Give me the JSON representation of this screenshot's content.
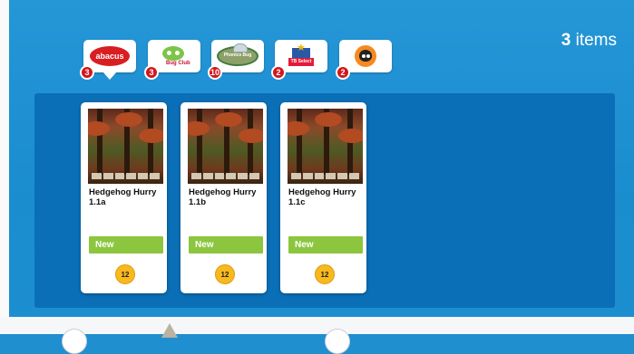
{
  "header": {
    "item_count": "3",
    "item_count_suffix": " items"
  },
  "tabs": [
    {
      "name": "abacus",
      "logo_text": "abacus",
      "badge": "3",
      "selected": true
    },
    {
      "name": "bug-club",
      "logo_text": "Bug Club",
      "badge": "3"
    },
    {
      "name": "phonics",
      "logo_text": "Phonics Bug",
      "badge": "10"
    },
    {
      "name": "select",
      "logo_text": "TB Select",
      "badge": "2"
    },
    {
      "name": "cat",
      "logo_text": "",
      "badge": "2"
    }
  ],
  "cards": [
    {
      "title": "Hedgehog Hurry 1.1a",
      "status": "New",
      "count": "12"
    },
    {
      "title": "Hedgehog Hurry 1.1b",
      "status": "New",
      "count": "12"
    },
    {
      "title": "Hedgehog Hurry 1.1c",
      "status": "New",
      "count": "12"
    }
  ],
  "colors": {
    "background": "#1f8fcf",
    "panel": "#0b6fb7",
    "badge": "#d2171c",
    "new": "#8cc63f",
    "count": "#f7b91e"
  }
}
